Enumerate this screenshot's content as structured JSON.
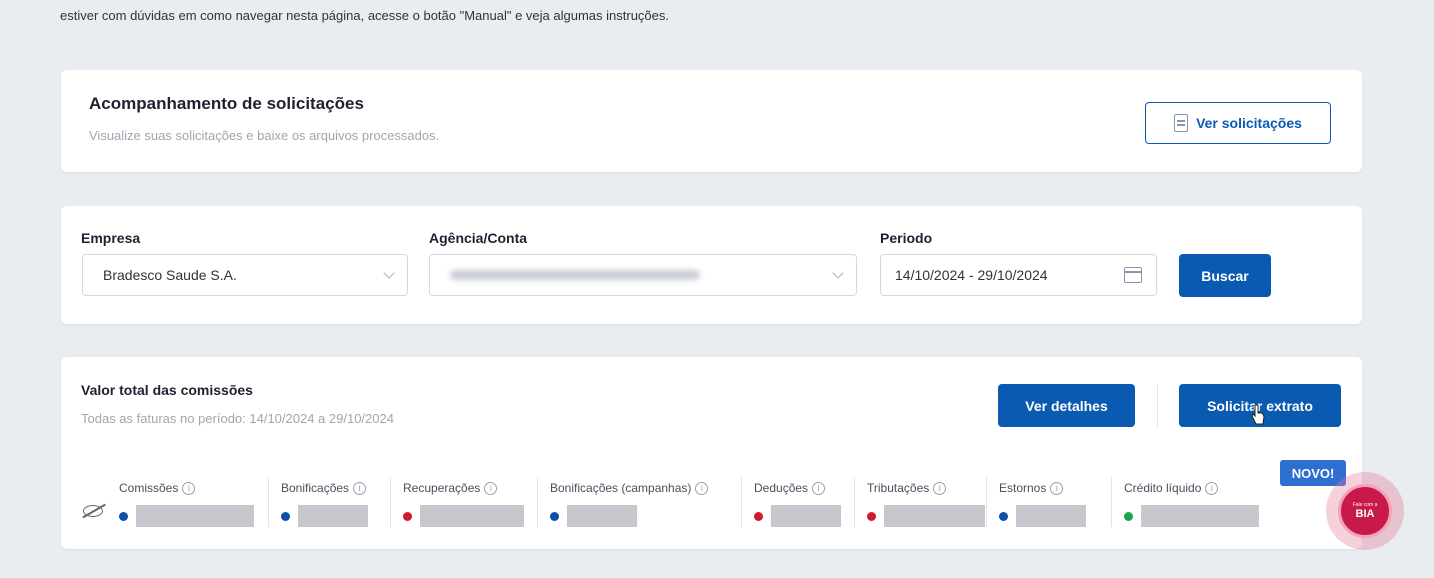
{
  "intro_text": "estiver com dúvidas em como navegar nesta página, acesse o botão \"Manual\" e veja algumas instruções.",
  "requests": {
    "title": "Acompanhamento de solicitações",
    "subtitle": "Visualize suas solicitações e baixe os arquivos processados.",
    "button_label": "Ver solicitações"
  },
  "filters": {
    "empresa_label": "Empresa",
    "empresa_value": "Bradesco Saude S.A.",
    "agencia_label": "Agência/Conta",
    "periodo_label": "Periodo",
    "periodo_value": "14/10/2024 - 29/10/2024",
    "search_button": "Buscar"
  },
  "totals": {
    "title": "Valor total das comissões",
    "subtitle": "Todas as faturas no período: 14/10/2024 a 29/10/2024",
    "details_button": "Ver detalhes",
    "extract_button": "Solicitar extrato",
    "new_badge": "NOVO!",
    "metrics": [
      {
        "label": "Comissões",
        "dot_color": "#0b4fa8"
      },
      {
        "label": "Bonificações",
        "dot_color": "#0b4fa8"
      },
      {
        "label": "Recuperações",
        "dot_color": "#d0182f"
      },
      {
        "label": "Bonificações (campanhas)",
        "dot_color": "#0b4fa8"
      },
      {
        "label": "Deduções",
        "dot_color": "#d0182f"
      },
      {
        "label": "Tributações",
        "dot_color": "#d0182f"
      },
      {
        "label": "Estornos",
        "dot_color": "#0b4fa8"
      },
      {
        "label": "Crédito líquido",
        "dot_color": "#1aa34a"
      }
    ]
  },
  "chat": {
    "small_text": "Fale com a",
    "name": "BIA"
  },
  "colors": {
    "primary": "#0b5ab1",
    "background": "#e9ecf0"
  }
}
